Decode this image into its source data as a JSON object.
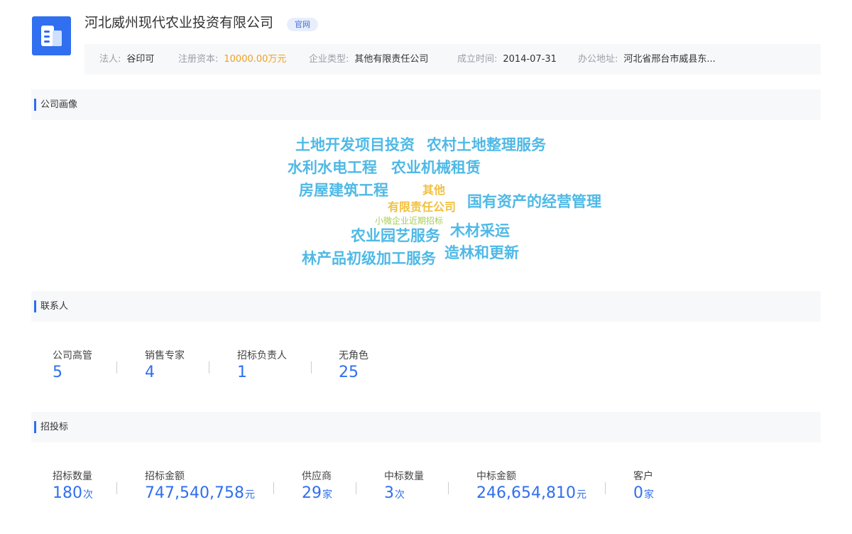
{
  "company": {
    "name": "河北威州现代农业投资有限公司",
    "site_badge": "官网",
    "logo_icon": "building-icon",
    "accent_color": "#2f6ff0"
  },
  "info": [
    {
      "label": "法人:",
      "value": "谷印可"
    },
    {
      "label": "注册资本:",
      "value": "10000.00万元"
    },
    {
      "label": "企业类型:",
      "value": "其他有限责任公司"
    },
    {
      "label": "成立时间:",
      "value": "2014-07-31"
    },
    {
      "label": "办公地址:",
      "value": "河北省邢台市威县东..."
    }
  ],
  "sections": {
    "profile": "公司画像",
    "contacts": "联系人",
    "bidding": "招投标"
  },
  "word_cloud": [
    "土地开发项目投资",
    "农村土地整理服务",
    "水利水电工程",
    "农业机械租赁",
    "房屋建筑工程",
    "其他",
    "有限责任公司",
    "国有资产的经营管理",
    "小微企业近期招标",
    "农业园艺服务",
    "木材采运",
    "林产品初级加工服务",
    "造林和更新"
  ],
  "contacts": [
    {
      "label": "公司高管",
      "value": "5"
    },
    {
      "label": "销售专家",
      "value": "4"
    },
    {
      "label": "招标负责人",
      "value": "1"
    },
    {
      "label": "无角色",
      "value": "25"
    }
  ],
  "bidding": [
    {
      "label": "招标数量",
      "value": "180",
      "unit": "次"
    },
    {
      "label": "招标金额",
      "value": "747,540,758",
      "unit": "元"
    },
    {
      "label": "供应商",
      "value": "29",
      "unit": "家"
    },
    {
      "label": "中标数量",
      "value": "3",
      "unit": "次"
    },
    {
      "label": "中标金额",
      "value": "246,654,810",
      "unit": "元"
    },
    {
      "label": "客户",
      "value": "0",
      "unit": "家"
    }
  ]
}
